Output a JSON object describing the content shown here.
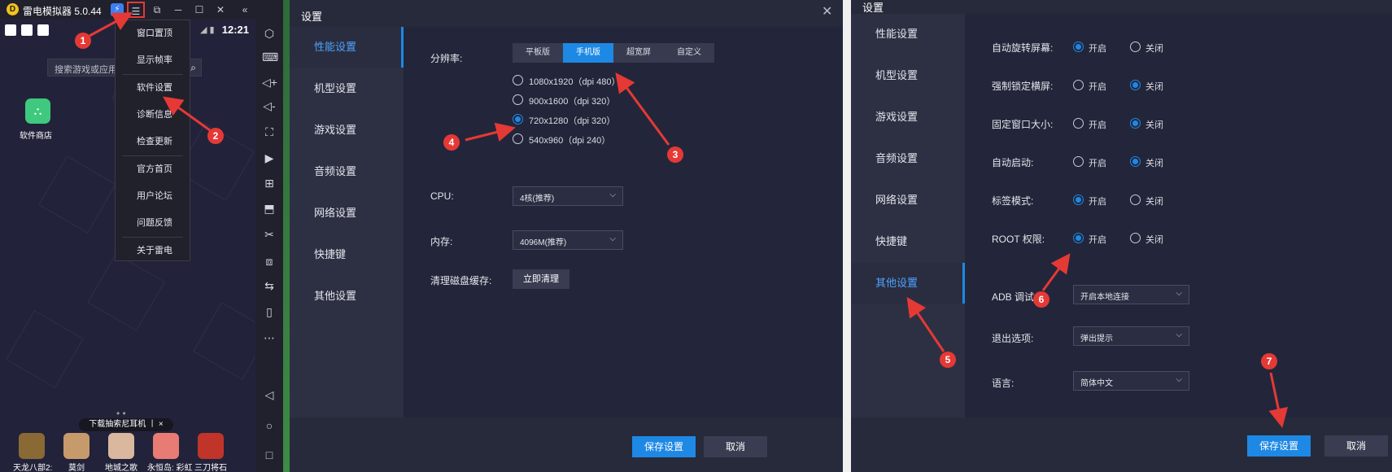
{
  "emulator": {
    "title": "雷电模拟器 5.0.44",
    "logo_glyph": "D",
    "titlebar_icons": [
      "boost-icon",
      "menu-icon",
      "fullscreen-icon",
      "minimize-icon",
      "maximize-icon",
      "close-icon",
      "collapse-icon"
    ],
    "status_time": "12:21",
    "search_placeholder": "搜索游戏或应用",
    "store_label": "软件商店",
    "dots": "• •",
    "banner_text": "下载抽索尼耳机 丨 ×",
    "games": [
      {
        "label": "天龙八部2:",
        "color": "#8a6a34"
      },
      {
        "label": "莫剑",
        "color": "#c79a6b"
      },
      {
        "label": "地城之歌",
        "color": "#d9b89e"
      },
      {
        "label": "永恒岛: 彩虹",
        "color": "#e87b74"
      },
      {
        "label": "三刀将石",
        "color": "#c0342a"
      }
    ],
    "menu": [
      "窗口置顶",
      "显示帧率",
      "软件设置",
      "诊断信息",
      "检查更新",
      "官方首页",
      "用户论坛",
      "问题反馈",
      "关于雷电"
    ]
  },
  "dialog1": {
    "title": "设置",
    "close": "✕",
    "nav": [
      "性能设置",
      "机型设置",
      "游戏设置",
      "音频设置",
      "网络设置",
      "快捷键",
      "其他设置"
    ],
    "active_nav": 0,
    "resolution_label": "分辨率:",
    "resolution_tabs": [
      "平板版",
      "手机版",
      "超宽屏",
      "自定义"
    ],
    "active_tab": 1,
    "resolutions": [
      {
        "label": "1080x1920（dpi 480）",
        "checked": false
      },
      {
        "label": "900x1600（dpi 320）",
        "checked": false
      },
      {
        "label": "720x1280（dpi 320）",
        "checked": true
      },
      {
        "label": "540x960（dpi 240）",
        "checked": false
      }
    ],
    "cpu_label": "CPU:",
    "cpu_value": "4核(推荐)",
    "memory_label": "内存:",
    "memory_value": "4096M(推荐)",
    "cache_label": "清理磁盘缓存:",
    "cache_button": "立即清理",
    "save": "保存设置",
    "cancel": "取消"
  },
  "dialog2": {
    "title": "设置",
    "close": "✕",
    "nav": [
      "性能设置",
      "机型设置",
      "游戏设置",
      "音频设置",
      "网络设置",
      "快捷键",
      "其他设置"
    ],
    "active_nav": 6,
    "on_label": "开启",
    "off_label": "关闭",
    "toggles": [
      {
        "label": "自动旋转屏幕:",
        "on": true
      },
      {
        "label": "强制锁定横屏:",
        "on": false
      },
      {
        "label": "固定窗口大小:",
        "on": false
      },
      {
        "label": "自动启动:",
        "on": false
      },
      {
        "label": "标签模式:",
        "on": true
      },
      {
        "label": "ROOT 权限:",
        "on": true
      }
    ],
    "adb_label": "ADB 调试:",
    "adb_value": "开启本地连接",
    "exit_label": "退出选项:",
    "exit_value": "弹出提示",
    "lang_label": "语言:",
    "lang_value": "简体中文",
    "save": "保存设置",
    "cancel": "取消"
  },
  "markers": [
    "1",
    "2",
    "3",
    "4",
    "5",
    "6",
    "7"
  ],
  "accent_color": "#1e88e5",
  "annotation_color": "#e53935"
}
